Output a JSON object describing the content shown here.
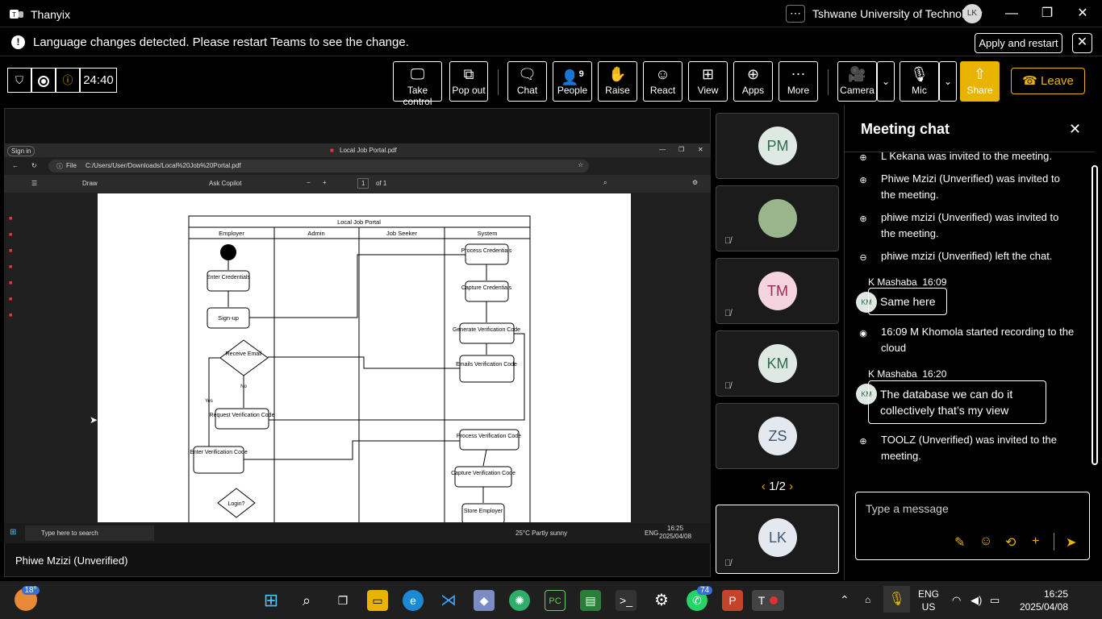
{
  "window": {
    "title": "Thanyix",
    "org": "Tshwane University of Technology",
    "user_initials": "LK"
  },
  "banner": {
    "message": "Language changes detected. Please restart Teams to see the change.",
    "apply": "Apply and restart"
  },
  "call": {
    "timer": "24:40"
  },
  "toolbar": {
    "take_control": "Take control",
    "pop_out": "Pop out",
    "chat": "Chat",
    "people": "People",
    "people_count": "9",
    "raise": "Raise",
    "react": "React",
    "view": "View",
    "apps": "Apps",
    "more": "More",
    "camera": "Camera",
    "mic": "Mic",
    "share": "Share",
    "leave": "Leave"
  },
  "accent_color": "#e8b400",
  "shared": {
    "sign_in": "Sign in",
    "tab_title": "Local Job Portal.pdf",
    "file": "File",
    "url": "C:/Users/User/Downloads/Local%20Job%20Portal.pdf",
    "draw": "Draw",
    "ask_copilot": "Ask Copilot",
    "page_num": "1",
    "page_of": "of 1",
    "diagram": {
      "title": "Local Job Portal",
      "lanes": [
        "Employer",
        "Admin",
        "Job Seeker",
        "System"
      ],
      "nodes": {
        "enter_credentials": "Enter Credentials",
        "sign_up": "Sign-up",
        "receive_email": "Receive Email",
        "no": "No",
        "yes": "Yes",
        "request_code": "Request Verification Code",
        "enter_code": "Enter Verification Code",
        "login": "Login?",
        "process_credentials": "Process Credentials",
        "capture_credentials": "Capture Credentials",
        "generate_code": "Generate Verification Code",
        "emails_code": "Emails Verification Code",
        "process_code": "Process Verification Code",
        "capture_code": "Capture Verification Code",
        "store_employer": "Store Employer"
      }
    },
    "taskbar": {
      "search": "Type here to search",
      "weather": "25°C  Partly sunny",
      "lang": "ENG",
      "time": "16:25",
      "date": "2025/04/08"
    }
  },
  "presenter": "Phiwe Mzizi (Unverified)",
  "participants": [
    {
      "initials": "PM",
      "bg": "#dfe9e4",
      "fg": "#2e6b4f"
    },
    {
      "initials": "",
      "bg": "#9ab58b",
      "fg": "#333"
    },
    {
      "initials": "TM",
      "bg": "#f4d4de",
      "fg": "#9b2a4f"
    },
    {
      "initials": "KM",
      "bg": "#dfe9e4",
      "fg": "#2e6b4f"
    },
    {
      "initials": "ZS",
      "bg": "#e4e9ef",
      "fg": "#3f5670"
    },
    {
      "initials": "LK",
      "bg": "#e4e9ef",
      "fg": "#3f5670"
    }
  ],
  "pager": "1/2",
  "chat": {
    "title": "Meeting chat",
    "events": {
      "e1": "L Kekana was invited to the meeting.",
      "e2": "Phiwe Mzizi (Unverified) was invited to the meeting.",
      "e3": "phiwe mzizi (Unverified) was invited to the meeting.",
      "e4": "phiwe mzizi (Unverified) left the chat.",
      "rec": "16:09    M Khomola started recording to the cloud",
      "e5": "TOOLZ (Unverified) was invited to the meeting."
    },
    "msg1": {
      "sender": "K Mashaba",
      "time": "16:09",
      "initials": "KM",
      "text": "Same here"
    },
    "msg2": {
      "sender": "K Mashaba",
      "time": "16:20",
      "initials": "KM",
      "text": "The database we can do it collectively that’s my view"
    },
    "placeholder": "Type a message"
  },
  "taskbar": {
    "weather_temp": "18°",
    "whatsapp_badge": "74",
    "lang1": "ENG",
    "lang2": "US",
    "time": "16:25",
    "date": "2025/04/08"
  }
}
